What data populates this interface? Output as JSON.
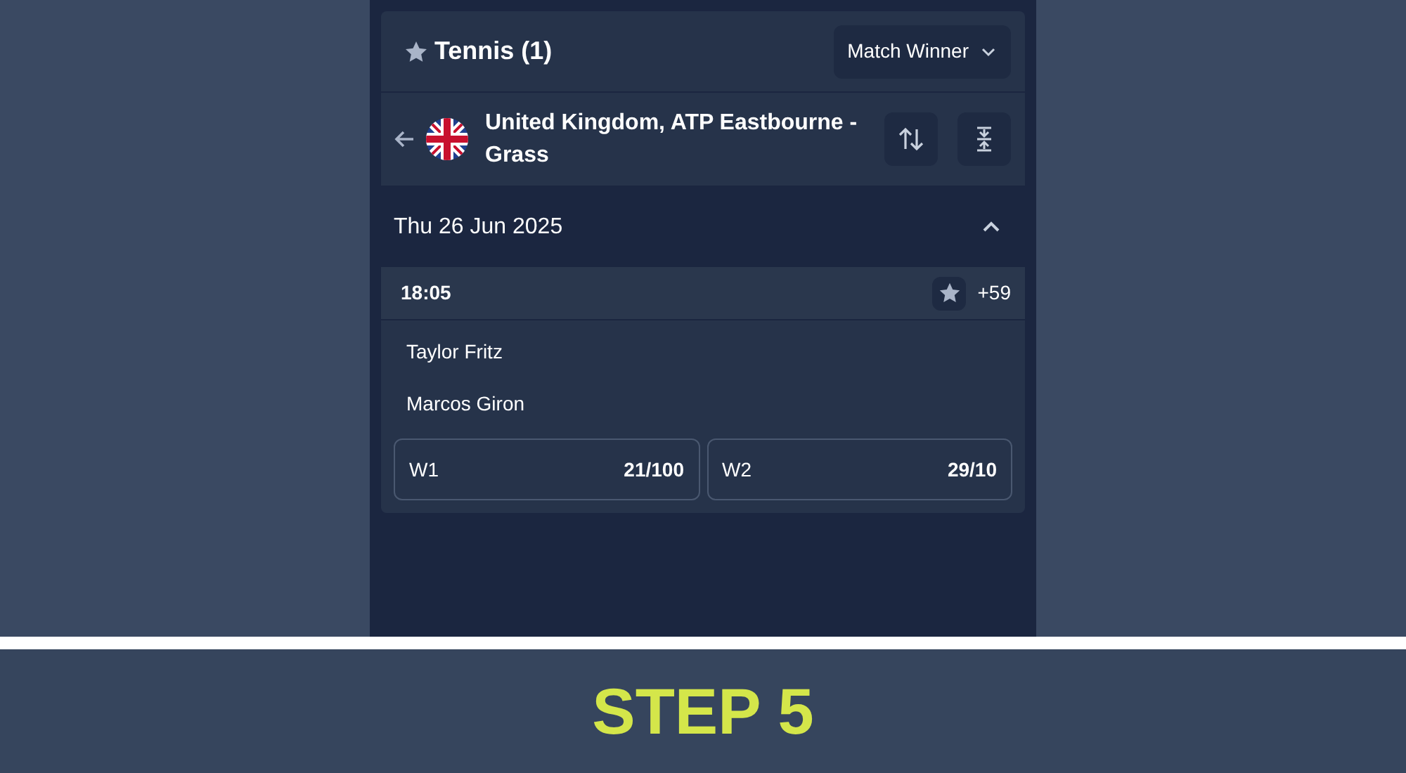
{
  "sport_header": {
    "title": "Tennis (1)",
    "market_dropdown": "Match Winner"
  },
  "league": {
    "name": "United Kingdom, ATP Eastbourne - Grass"
  },
  "date_group": {
    "date": "Thu 26 Jun 2025",
    "expanded": true
  },
  "match": {
    "time": "18:05",
    "more_markets": "+59",
    "players": [
      "Taylor Fritz",
      "Marcos Giron"
    ],
    "odds": [
      {
        "label": "W1",
        "value": "21/100"
      },
      {
        "label": "W2",
        "value": "29/10"
      }
    ]
  },
  "banner": {
    "text": "STEP 5"
  }
}
